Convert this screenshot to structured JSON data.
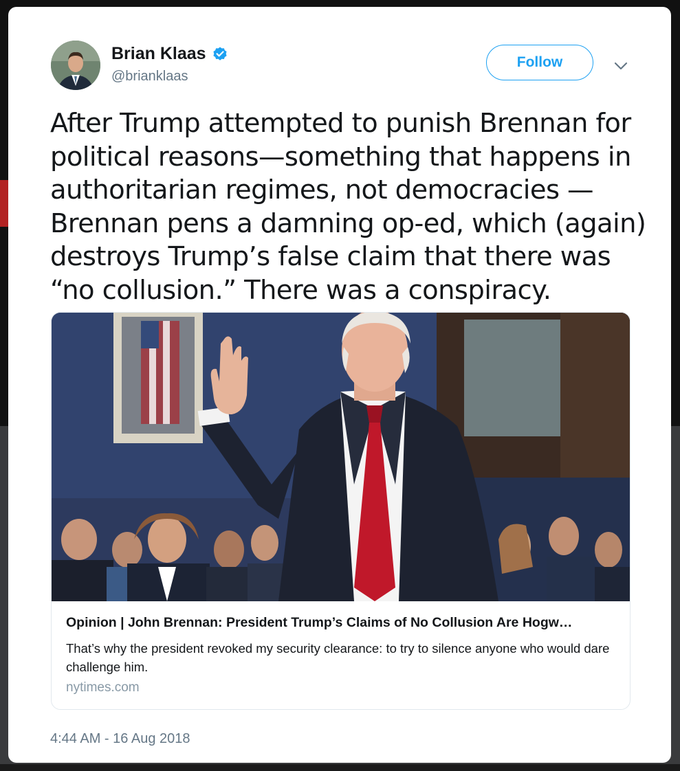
{
  "tweet": {
    "author_name": "Brian Klaas",
    "author_handle": "@brianklaas",
    "follow_label": "Follow",
    "text": "After Trump attempted to punish Brennan for political reasons—something that happens in authoritarian regimes, not democracies —Brennan pens a damning op-ed, which (again) destroys Trump’s false claim that there was “no collusion.” There was a conspiracy.",
    "timestamp": "4:44 AM - 16 Aug 2018"
  },
  "link_card": {
    "title": "Opinion | John Brennan: President Trump’s Claims of No Collusion Are Hogw…",
    "description": "That’s why the president revoked my security clearance: to try to silence anyone who would dare challenge him.",
    "domain": "nytimes.com"
  },
  "colors": {
    "accent": "#1da1f2",
    "text_primary": "#14171a",
    "text_secondary": "#657786",
    "tie_red": "#c0182a"
  },
  "icons": [
    "verified-badge-icon",
    "chevron-down-icon"
  ]
}
